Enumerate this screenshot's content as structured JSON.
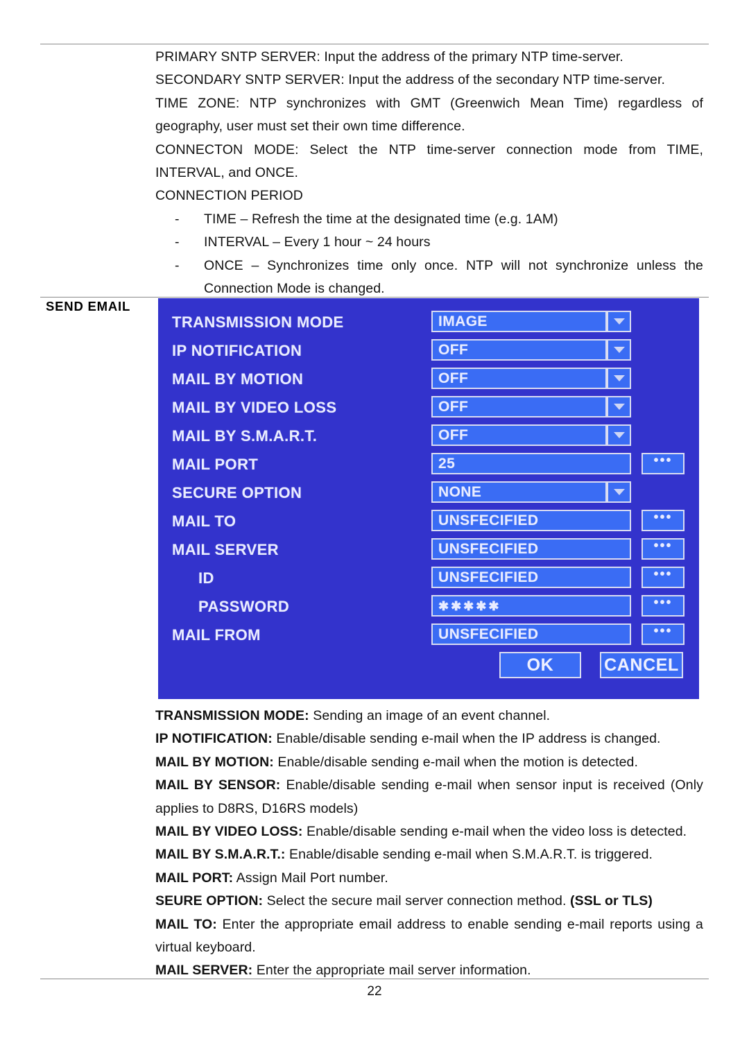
{
  "document": {
    "page_number": "22",
    "section_label": "SEND EMAIL"
  },
  "top_paragraphs": [
    "PRIMARY SNTP SERVER: Input the address of the primary NTP time-server.",
    "SECONDARY SNTP SERVER: Input the address of the secondary NTP time-server.",
    "TIME ZONE: NTP synchronizes with GMT (Greenwich Mean Time) regardless of geography, user must set their own time difference.",
    "CONNECTON MODE: Select the NTP time-server connection mode from TIME, INTERVAL, and ONCE.",
    "CONNECTION PERIOD"
  ],
  "connection_period_items": [
    {
      "dash": "-",
      "text": "TIME – Refresh the time at the designated time (e.g. 1AM)"
    },
    {
      "dash": "-",
      "text": "INTERVAL – Every 1 hour ~ 24 hours"
    },
    {
      "dash": "-",
      "text": "ONCE – Synchronizes time only once. NTP will not synchronize unless the Connection Mode is changed."
    }
  ],
  "dialog": {
    "colors": {
      "background": "#3333cc",
      "field_fill": "#3a6cf4",
      "field_border": "#d9dcf2",
      "text": "#e9ecff"
    },
    "rows": [
      {
        "label": "TRANSMISSION MODE",
        "indent": false,
        "control": "dropdown",
        "value": "IMAGE"
      },
      {
        "label": "IP NOTIFICATION",
        "indent": false,
        "control": "dropdown",
        "value": "OFF"
      },
      {
        "label": "MAIL BY MOTION",
        "indent": false,
        "control": "dropdown",
        "value": "OFF"
      },
      {
        "label": "MAIL BY VIDEO LOSS",
        "indent": false,
        "control": "dropdown",
        "value": "OFF"
      },
      {
        "label": "MAIL BY S.M.A.R.T.",
        "indent": false,
        "control": "dropdown",
        "value": "OFF"
      },
      {
        "label": "MAIL PORT",
        "indent": false,
        "control": "browse",
        "value": "25"
      },
      {
        "label": "SECURE OPTION",
        "indent": false,
        "control": "dropdown",
        "value": "NONE"
      },
      {
        "label": "MAIL TO",
        "indent": false,
        "control": "browse",
        "value": "UNSFECIFIED"
      },
      {
        "label": "MAIL SERVER",
        "indent": false,
        "control": "browse",
        "value": "UNSFECIFIED"
      },
      {
        "label": "ID",
        "indent": true,
        "control": "browse",
        "value": "UNSFECIFIED"
      },
      {
        "label": "PASSWORD",
        "indent": true,
        "control": "browse",
        "value": "✱✱✱✱✱",
        "masked": true
      },
      {
        "label": "MAIL FROM",
        "indent": false,
        "control": "browse",
        "value": "UNSFECIFIED"
      }
    ],
    "browse_button_label": "•••",
    "ok_label": "OK",
    "cancel_label": "CANCEL"
  },
  "bottom_paragraphs": [
    {
      "bold": "TRANSMISSION MODE:",
      "rest": " Sending an image of an event channel.",
      "justify": false
    },
    {
      "bold": "IP NOTIFICATION:",
      "rest": " Enable/disable sending e-mail when the IP address is changed.",
      "justify": false
    },
    {
      "bold": "MAIL BY MOTION:",
      "rest": " Enable/disable sending e-mail when the motion is detected.",
      "justify": false
    },
    {
      "bold": "MAIL BY SENSOR:",
      "rest": " Enable/disable sending e-mail when sensor input is received (Only applies to D8RS, D16RS models)",
      "justify": true
    },
    {
      "bold": "MAIL BY VIDEO LOSS:",
      "rest": " Enable/disable sending e-mail when the video loss is detected.",
      "justify": false
    },
    {
      "bold": "MAIL BY S.M.A.R.T.:",
      "rest": " Enable/disable sending e-mail when S.M.A.R.T. is triggered.",
      "justify": false
    },
    {
      "bold": "MAIL PORT:",
      "rest": " Assign Mail Port number.",
      "justify": false
    },
    {
      "bold": "SEURE OPTION:",
      "rest": " Select the secure mail server connection method. ",
      "bold_tail": "(SSL or TLS)",
      "justify": false
    },
    {
      "bold": "MAIL TO:",
      "rest": " Enter the appropriate email address to enable sending e-mail reports using a virtual keyboard.",
      "justify": true
    },
    {
      "bold": "MAIL SERVER:",
      "rest": " Enter the appropriate mail server information.",
      "justify": false
    }
  ]
}
